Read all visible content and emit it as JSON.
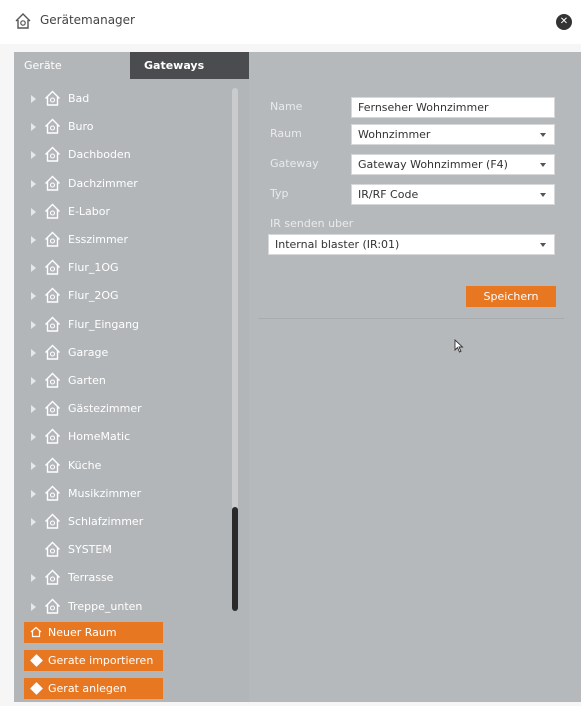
{
  "window": {
    "title": "Gerätemanager",
    "close_symbol": "✕"
  },
  "tabs": [
    {
      "label": "Geräte",
      "active": true
    },
    {
      "label": "Gateways",
      "active": false
    }
  ],
  "rooms": [
    {
      "label": "Bad",
      "expandable": true
    },
    {
      "label": "Buro",
      "expandable": true
    },
    {
      "label": "Dachboden",
      "expandable": true
    },
    {
      "label": "Dachzimmer",
      "expandable": true
    },
    {
      "label": "E-Labor",
      "expandable": true
    },
    {
      "label": "Esszimmer",
      "expandable": true
    },
    {
      "label": "Flur_1OG",
      "expandable": true
    },
    {
      "label": "Flur_2OG",
      "expandable": true
    },
    {
      "label": "Flur_Eingang",
      "expandable": true
    },
    {
      "label": "Garage",
      "expandable": true
    },
    {
      "label": "Garten",
      "expandable": true
    },
    {
      "label": "Gästezimmer",
      "expandable": true
    },
    {
      "label": "HomeMatic",
      "expandable": true
    },
    {
      "label": "Küche",
      "expandable": true
    },
    {
      "label": "Musikzimmer",
      "expandable": true
    },
    {
      "label": "Schlafzimmer",
      "expandable": true
    },
    {
      "label": "SYSTEM",
      "expandable": false
    },
    {
      "label": "Terrasse",
      "expandable": true
    },
    {
      "label": "Treppe_unten",
      "expandable": true
    }
  ],
  "actions": {
    "new_room": "Neuer Raum",
    "import_devices": "Gerate importieren",
    "create_device": "Gerat anlegen"
  },
  "form": {
    "name_label": "Name",
    "name_value": "Fernseher Wohnzimmer",
    "room_label": "Raum",
    "room_value": "Wohnzimmer",
    "gateway_label": "Gateway",
    "gateway_value": "Gateway Wohnzimmer (F4)",
    "type_label": "Typ",
    "type_value": "IR/RF Code",
    "ir_label": "IR senden uber",
    "ir_value": "Internal blaster (IR:01)",
    "save_label": "Speichern"
  },
  "colors": {
    "accent": "#e87722",
    "panel_bg": "#b6b9bc",
    "tab_inactive": "#4a4c4f"
  },
  "icons": {
    "app": "house-gear-icon",
    "room": "house-icon",
    "close": "close-circle-icon",
    "expand": "triangle-right-icon",
    "dropdown": "caret-down-icon"
  }
}
